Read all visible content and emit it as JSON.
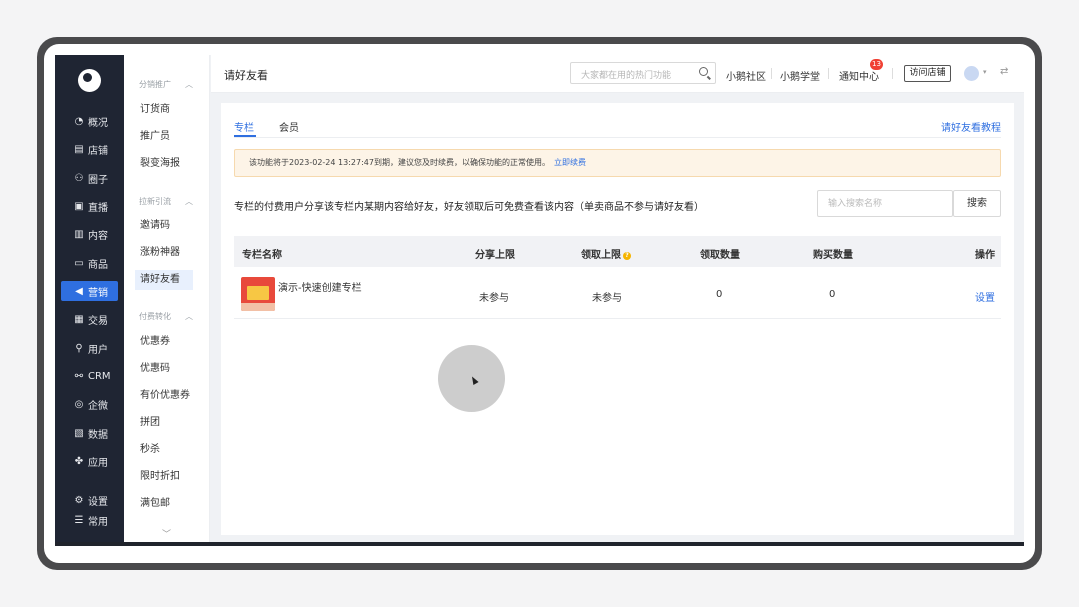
{
  "nav": {
    "items": [
      {
        "icon": "chart-icon",
        "glyph": "◔",
        "label": "概况"
      },
      {
        "icon": "store-icon",
        "glyph": "▤",
        "label": "店铺"
      },
      {
        "icon": "community-icon",
        "glyph": "⚇",
        "label": "圈子"
      },
      {
        "icon": "live-icon",
        "glyph": "▣",
        "label": "直播"
      },
      {
        "icon": "content-icon",
        "glyph": "▥",
        "label": "内容"
      },
      {
        "icon": "goods-icon",
        "glyph": "▭",
        "label": "商品"
      },
      {
        "icon": "marketing-icon",
        "glyph": "◀",
        "label": "营销"
      },
      {
        "icon": "trade-icon",
        "glyph": "▦",
        "label": "交易"
      },
      {
        "icon": "user-icon",
        "glyph": "⚲",
        "label": "用户"
      },
      {
        "icon": "crm-icon",
        "glyph": "⚯",
        "label": "CRM"
      },
      {
        "icon": "wecom-icon",
        "glyph": "◎",
        "label": "企微"
      },
      {
        "icon": "data-icon",
        "glyph": "▧",
        "label": "数据"
      },
      {
        "icon": "apps-icon",
        "glyph": "✤",
        "label": "应用"
      },
      {
        "icon": "settings-icon",
        "glyph": "⚙",
        "label": "设置"
      },
      {
        "icon": "common-icon",
        "glyph": "☰",
        "label": "常用"
      }
    ],
    "active_index": 6
  },
  "submenu": {
    "groups": [
      {
        "title": "分销推广",
        "items": [
          "订货商",
          "推广员",
          "裂变海报"
        ]
      },
      {
        "title": "拉新引流",
        "items": [
          "邀请码",
          "涨粉神器",
          "请好友看"
        ]
      },
      {
        "title": "付费转化",
        "items": [
          "优惠券",
          "优惠码",
          "有价优惠券",
          "拼团",
          "秒杀",
          "限时折扣",
          "满包邮"
        ]
      }
    ],
    "active_item": "请好友看"
  },
  "topbar": {
    "page_title": "请好友看",
    "search_placeholder": "大家都在用的热门功能",
    "links": [
      "小鹅社区",
      "小鹅学堂",
      "通知中心"
    ],
    "notification_count": "13",
    "visit_store_label": "访问店铺"
  },
  "main": {
    "tabs": [
      "专栏",
      "会员"
    ],
    "active_tab": 0,
    "help_link": "请好友看教程",
    "notice_text": "该功能将于2023-02-24 13:27:47到期，建议您及时续费，以确保功能的正常使用。",
    "notice_link": "立即续费",
    "description": "专栏的付费用户分享该专栏内某期内容给好友，好友领取后可免费查看该内容（单卖商品不参与请好友看）",
    "search_placeholder": "输入搜索名称",
    "search_button": "搜索",
    "table": {
      "headers": [
        "专栏名称",
        "分享上限",
        "领取上限",
        "领取数量",
        "购买数量",
        "操作"
      ],
      "rows": [
        {
          "name": "演示-快速创建专栏",
          "share_limit": "未参与",
          "claim_limit": "未参与",
          "claimed": "0",
          "purchased": "0",
          "action": "设置"
        }
      ]
    }
  }
}
